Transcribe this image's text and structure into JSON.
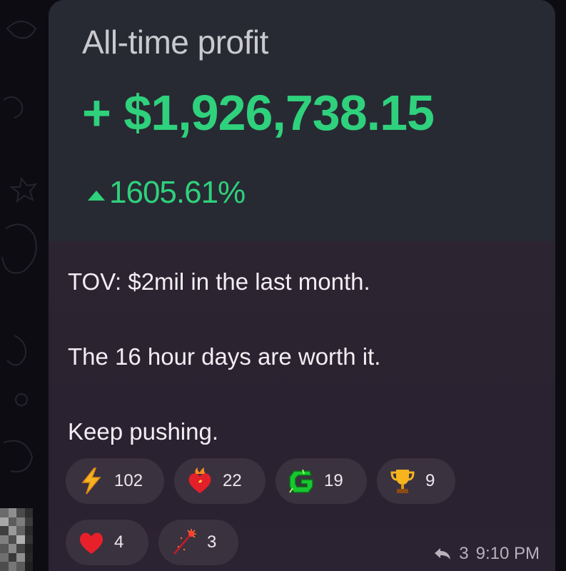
{
  "profit_card": {
    "title": "All-time profit",
    "amount": "+ $1,926,738.15",
    "percent": "1605.61%",
    "percent_direction_icon": "triangle-up-icon",
    "accent_color": "#2fd17c"
  },
  "message": {
    "line1": "TOV: $2mil in the last month.",
    "line2": "The 16 hour days are worth it.",
    "line3": "Keep pushing."
  },
  "reactions": [
    {
      "icon": "lightning-icon",
      "count": "102"
    },
    {
      "icon": "flaming-heart-icon",
      "count": "22"
    },
    {
      "icon": "green-g-sticker-icon",
      "count": "19"
    },
    {
      "icon": "trophy-icon",
      "count": "9"
    },
    {
      "icon": "red-heart-icon",
      "count": "4"
    },
    {
      "icon": "sparkler-icon",
      "count": "3"
    }
  ],
  "meta": {
    "reply_icon": "reply-arrow-icon",
    "reply_count": "3",
    "time": "9:10 PM"
  }
}
